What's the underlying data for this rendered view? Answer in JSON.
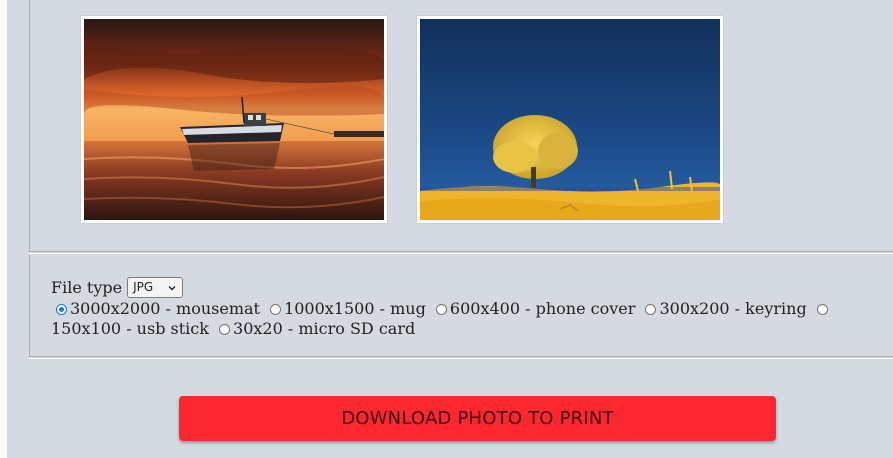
{
  "gallery": {
    "photos": [
      {
        "name": "boat-sunset-photo"
      },
      {
        "name": "yellow-tree-photo"
      }
    ]
  },
  "options": {
    "file_type_label": "File type",
    "file_type_selected": "JPG",
    "sizes": [
      {
        "label": "3000x2000 - mousemat",
        "checked": true
      },
      {
        "label": "1000x1500 - mug",
        "checked": false
      },
      {
        "label": "600x400 - phone cover",
        "checked": false
      },
      {
        "label": "300x200 - keyring",
        "checked": false
      },
      {
        "label": "150x100 - usb stick",
        "checked": false
      },
      {
        "label": "30x20 - micro SD card",
        "checked": false
      }
    ]
  },
  "actions": {
    "download_label": "DOWNLOAD PHOTO TO PRINT"
  },
  "colors": {
    "page_bg": "#d4dadf",
    "button_bg": "#fd282f",
    "radio_accent": "#1a73e8"
  }
}
